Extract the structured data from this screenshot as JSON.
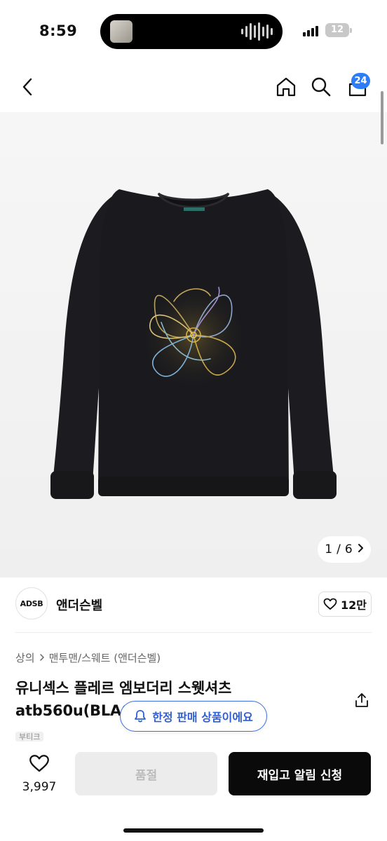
{
  "status_bar": {
    "time": "8:59",
    "battery": "12",
    "signal_icon": "cellular-signal-icon",
    "island_wave_icon": "audio-waveform-icon"
  },
  "header": {
    "back_icon": "chevron-left-icon",
    "home_icon": "home-icon",
    "search_icon": "search-icon",
    "cart_icon": "shopping-bag-icon",
    "cart_count": "24",
    "badge_color": "#2f7df6"
  },
  "hero": {
    "pager_current": "1",
    "pager_separator": "/",
    "pager_total": "6",
    "pager_icon": "chevron-right-icon",
    "garment_color": "#1a1a1e"
  },
  "brand": {
    "logo_text": "ADSB",
    "name": "앤더슨벨",
    "like_icon": "heart-outline-icon",
    "like_count": "12만"
  },
  "breadcrumb": {
    "items": [
      "상의",
      "맨투맨/스웨트 (앤더슨벨)"
    ],
    "separator_icon": "chevron-right-icon"
  },
  "product": {
    "title": "유니섹스 플레르 엠보더리 스웻셔츠 atb560u(BLACK)",
    "share_icon": "share-icon",
    "limited_text": "한정 판매 상품이에요",
    "limited_icon": "bell-icon",
    "boutique_label": "부티크",
    "accent_color": "#3b6fe0"
  },
  "bottom_bar": {
    "wish_icon": "heart-outline-icon",
    "wish_count": "3,997",
    "soldout_label": "품절",
    "restock_label": "재입고 알림 신청"
  }
}
